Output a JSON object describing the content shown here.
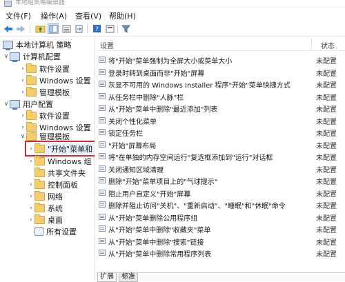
{
  "window": {
    "title": "本地组策略编辑器"
  },
  "menu": [
    {
      "label": "文件(F)"
    },
    {
      "label": "操作(A)"
    },
    {
      "label": "查看(V)"
    },
    {
      "label": "帮助(H)"
    }
  ],
  "tree": {
    "root": "本地计算机 策略",
    "computer_config": "计算机配置",
    "user_config": "用户配置",
    "software_settings": "软件设置",
    "windows_settings": "Windows 设置",
    "admin_templates": "管理模板",
    "start_menu": "\"开始\"菜单和",
    "windows_components": "Windows 组",
    "shared_folders": "共享文件夹",
    "control_panel": "控制面板",
    "network": "网络",
    "system": "系统",
    "desktop": "桌面",
    "all_settings": "所有设置"
  },
  "list": {
    "header_setting": "设置",
    "header_state": "状态",
    "rows": [
      {
        "name": "将\"开始\"菜单强制为全屏大小或菜单大小",
        "state": "未配置"
      },
      {
        "name": "登录时转到桌面而非\"开始\"屏幕",
        "state": "未配置"
      },
      {
        "name": "灰显不可用的 Windows Installer 程序\"开始\"菜单快捷方式",
        "state": "未配置"
      },
      {
        "name": "从任务栏中删除\"人脉\"栏",
        "state": "未配置"
      },
      {
        "name": "从\"开始\"菜单中删除\"最近添加\"列表",
        "state": "未配置"
      },
      {
        "name": "关闭个性化菜单",
        "state": "未配置"
      },
      {
        "name": "锁定任务栏",
        "state": "未配置"
      },
      {
        "name": "\"开始\"屏幕布局",
        "state": "未配置"
      },
      {
        "name": "将\"在单独的内存空间运行\"复选框添加到\"运行\"对话框",
        "state": "未配置"
      },
      {
        "name": "关闭通知区域清理",
        "state": "未配置"
      },
      {
        "name": "删除\"开始\"菜单项目上的\"气球提示\"",
        "state": "未配置"
      },
      {
        "name": "阻止用户自定义\"开始\"屏幕",
        "state": "未配置"
      },
      {
        "name": "删除并阻止访问\"关机\"、\"重新启动\"、\"睡眠\"和\"休眠\"命令",
        "state": "未配置"
      },
      {
        "name": "从\"开始\"菜单删除公用程序组",
        "state": "未配置"
      },
      {
        "name": "从\"开始\"菜单中删除\"收藏夹\"菜单",
        "state": "未配置"
      },
      {
        "name": "从\"开始\"菜单中删除\"搜索\"链接",
        "state": "未配置"
      },
      {
        "name": "从\"开始\"菜单中删除常用程序列表",
        "state": "未配置"
      }
    ]
  },
  "tabs": [
    {
      "label": "扩展"
    },
    {
      "label": "标准"
    }
  ],
  "colors": {
    "highlight": "#e3262b",
    "folder": "#f3ce6c",
    "selection": "#e5f1fb"
  }
}
